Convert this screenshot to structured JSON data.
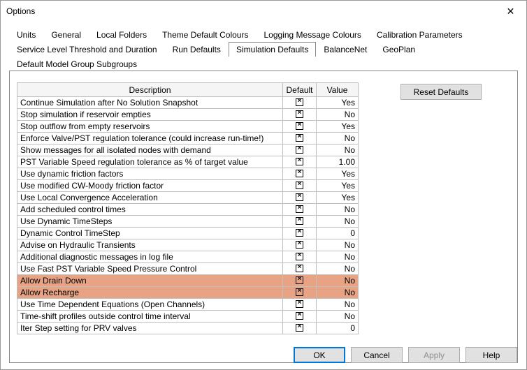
{
  "window": {
    "title": "Options"
  },
  "tabs_row1": [
    {
      "label": "Units"
    },
    {
      "label": "General"
    },
    {
      "label": "Local Folders"
    },
    {
      "label": "Theme Default Colours"
    },
    {
      "label": "Logging Message Colours"
    },
    {
      "label": "Calibration Parameters"
    }
  ],
  "tabs_row2": [
    {
      "label": "Service Level Threshold and Duration"
    },
    {
      "label": "Run Defaults"
    },
    {
      "label": "Simulation Defaults",
      "active": true
    },
    {
      "label": "BalanceNet"
    },
    {
      "label": "GeoPlan"
    },
    {
      "label": "Default Model Group Subgroups"
    }
  ],
  "table": {
    "headers": {
      "description": "Description",
      "default": "Default",
      "value": "Value"
    },
    "rows": [
      {
        "desc": "Continue Simulation after No Solution Snapshot",
        "value": "Yes"
      },
      {
        "desc": "Stop simulation if reservoir empties",
        "value": "No"
      },
      {
        "desc": "Stop outflow from empty reservoirs",
        "value": "Yes"
      },
      {
        "desc": "Enforce Valve/PST regulation tolerance (could increase run-time!)",
        "value": "No"
      },
      {
        "desc": "Show messages for all isolated nodes with demand",
        "value": "No"
      },
      {
        "desc": "PST Variable Speed regulation tolerance as % of target value",
        "value": "1.00"
      },
      {
        "desc": "Use dynamic friction factors",
        "value": "Yes"
      },
      {
        "desc": "Use modified CW-Moody friction factor",
        "value": "Yes"
      },
      {
        "desc": "Use Local Convergence Acceleration",
        "value": "Yes"
      },
      {
        "desc": "Add scheduled control times",
        "value": "No"
      },
      {
        "desc": "Use Dynamic TimeSteps",
        "value": "No"
      },
      {
        "desc": "Dynamic Control TimeStep",
        "value": "0"
      },
      {
        "desc": "Advise on Hydraulic Transients",
        "value": "No"
      },
      {
        "desc": "Additional diagnostic messages in log file",
        "value": "No"
      },
      {
        "desc": "Use Fast PST Variable Speed Pressure Control",
        "value": "No"
      },
      {
        "desc": "Allow Drain Down",
        "value": "No",
        "highlight": true
      },
      {
        "desc": "Allow Recharge",
        "value": "No",
        "highlight": true
      },
      {
        "desc": "Use Time Dependent Equations (Open Channels)",
        "value": "No"
      },
      {
        "desc": "Time-shift profiles outside control time interval",
        "value": "No"
      },
      {
        "desc": "Iter Step setting for PRV valves",
        "value": "0"
      }
    ]
  },
  "reset_label": "Reset Defaults",
  "footer": {
    "ok": "OK",
    "cancel": "Cancel",
    "apply": "Apply",
    "help": "Help"
  }
}
